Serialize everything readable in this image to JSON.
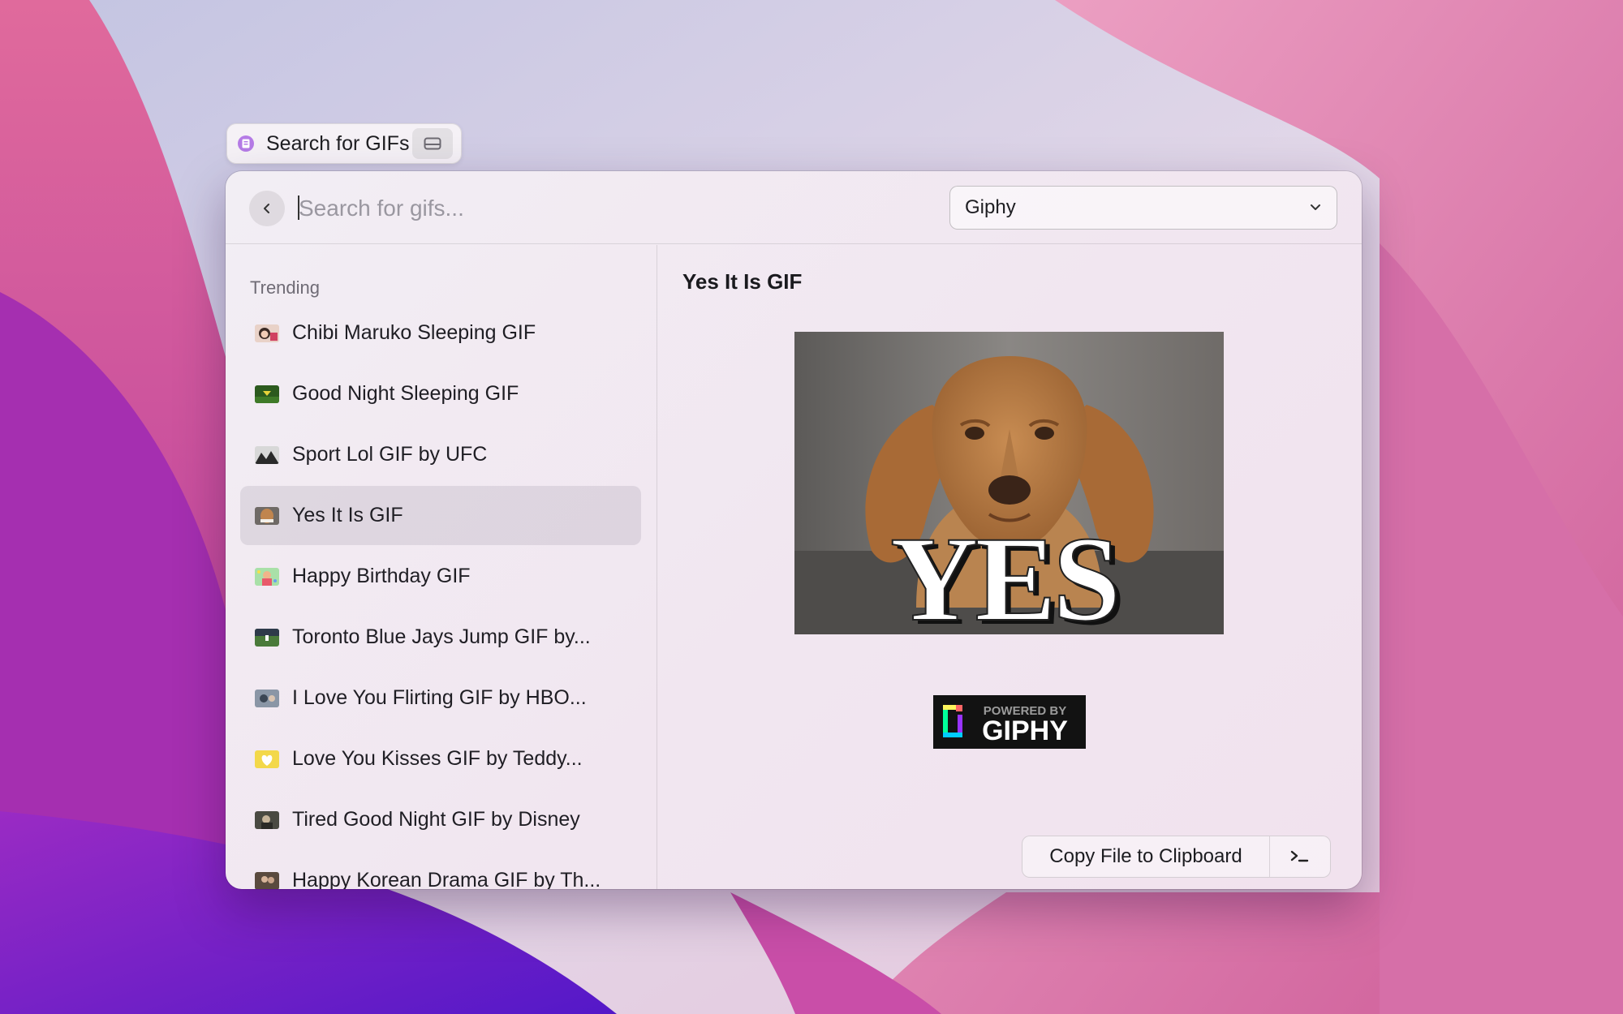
{
  "command": {
    "title": "Search for GIFs",
    "icon": "giphy-extension-icon",
    "action_icon": "drive-icon"
  },
  "search": {
    "placeholder": "Search for gifs...",
    "value": "",
    "back_icon": "chevron-left-icon"
  },
  "source_dropdown": {
    "selected": "Giphy",
    "icon": "chevron-down-icon"
  },
  "list": {
    "section_title": "Trending",
    "items": [
      {
        "label": "Chibi Maruko Sleeping GIF"
      },
      {
        "label": "Good Night Sleeping GIF"
      },
      {
        "label": "Sport Lol GIF by UFC"
      },
      {
        "label": "Yes It Is GIF",
        "selected": true
      },
      {
        "label": "Happy Birthday GIF"
      },
      {
        "label": "Toronto Blue Jays Jump GIF by..."
      },
      {
        "label": "I Love You Flirting GIF by HBO..."
      },
      {
        "label": "Love You Kisses GIF by Teddy..."
      },
      {
        "label": "Tired Good Night GIF by Disney"
      },
      {
        "label": "Happy Korean Drama GIF by Th..."
      }
    ]
  },
  "detail": {
    "title": "Yes It Is GIF",
    "preview_caption": "YES",
    "badge_top": "POWERED BY",
    "badge_brand": "GIPHY"
  },
  "actions": {
    "primary_label": "Copy File to Clipboard",
    "secondary_icon": "terminal-icon"
  },
  "colors": {
    "selection": "#e3d8e3",
    "window_bg": "#f2eaf2",
    "wallpaper_pink": "#d35c9c",
    "wallpaper_purple": "#6a1fc8"
  }
}
